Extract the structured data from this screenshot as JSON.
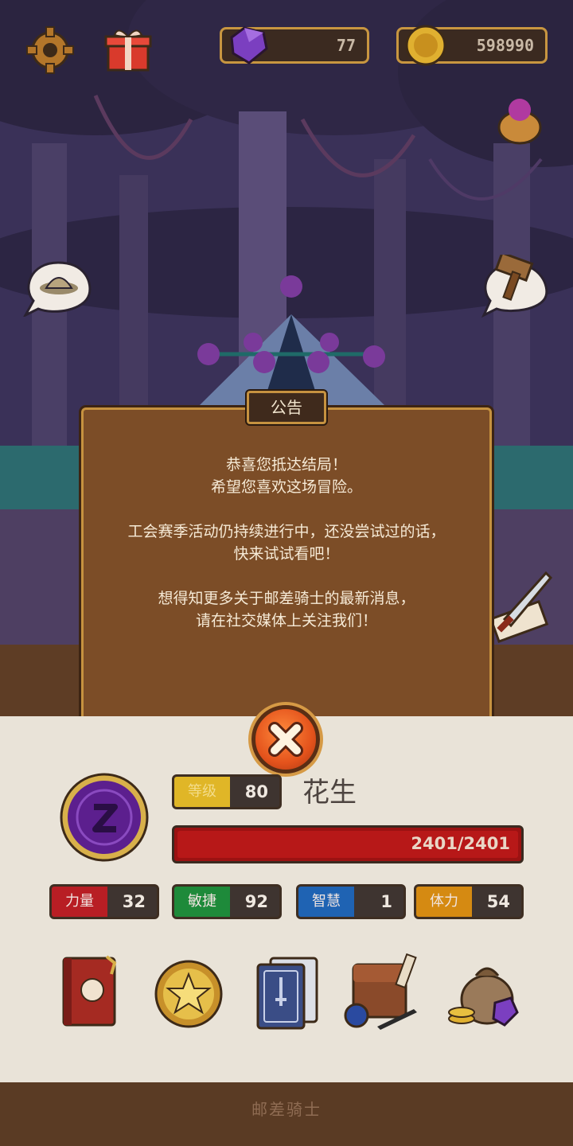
{
  "topbar": {
    "gems": "77",
    "coins": "598990",
    "settings_icon": "gear-icon",
    "gift_icon": "gift-icon"
  },
  "notice": {
    "title": "公告",
    "lines": [
      "恭喜您抵达结局！",
      "希望您喜欢这场冒险。",
      "工会赛季活动仍持续进行中，还没尝试过的话，",
      "快来试试看吧！",
      "想得知更多关于邮差骑士的最新消息，",
      "请在社交媒体上关注我们！"
    ]
  },
  "player": {
    "name": "花生",
    "level_label": "等级",
    "level": "80",
    "hp": "2401/2401",
    "hp_fraction": 1.0
  },
  "stats": [
    {
      "label": "力量",
      "value": "32",
      "color": "#b81e24"
    },
    {
      "label": "敏捷",
      "value": "92",
      "color": "#1e8a3a"
    },
    {
      "label": "智慧",
      "value": "1",
      "color": "#1f63b3"
    },
    {
      "label": "体力",
      "value": "54",
      "color": "#d58a12"
    }
  ],
  "footer": {
    "title": "邮差骑士"
  },
  "colors": {
    "wood_dark": "#5a3b24",
    "notice_bg": "#7c4d27",
    "gold_border": "#c69240",
    "close_orange": "#e4531c"
  }
}
